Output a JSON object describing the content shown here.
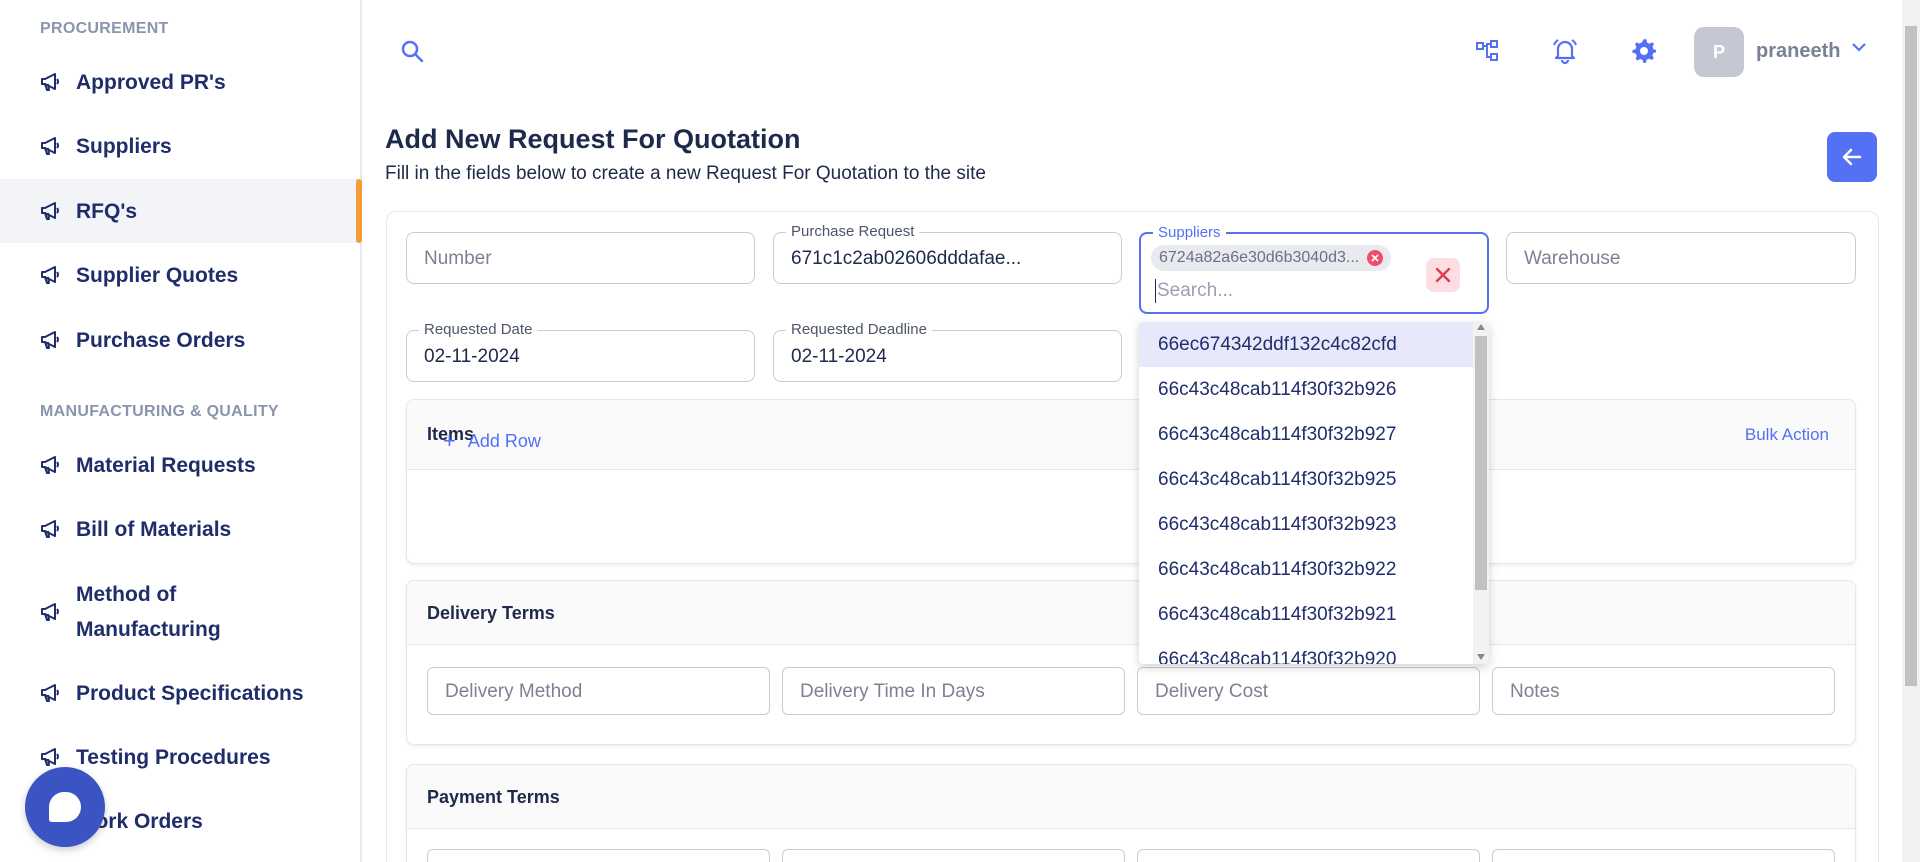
{
  "sidebar": {
    "section_procurement": "PROCUREMENT",
    "section_manufacturing": "MANUFACTURING & QUALITY",
    "items": [
      {
        "label": "Approved PR's"
      },
      {
        "label": "Suppliers"
      },
      {
        "label": "RFQ's"
      },
      {
        "label": "Supplier Quotes"
      },
      {
        "label": "Purchase Orders"
      },
      {
        "label": "Material Requests"
      },
      {
        "label": "Bill of Materials"
      },
      {
        "label": "Method of Manufacturing"
      },
      {
        "label": "Product Specifications"
      },
      {
        "label": "Testing Procedures"
      },
      {
        "label": "Work Orders"
      }
    ]
  },
  "topbar": {
    "avatar_initial": "P",
    "username": "praneeth"
  },
  "page": {
    "title": "Add New Request For Quotation",
    "subtitle": "Fill in the fields below to create a new Request For Quotation to the site"
  },
  "form": {
    "number": {
      "placeholder": "Number"
    },
    "purchase_request": {
      "label": "Purchase Request",
      "value": "671c1c2ab02606dddafae..."
    },
    "suppliers": {
      "label": "Suppliers",
      "chip": "6724a82a6e30d6b3040d3...",
      "search_placeholder": "Search..."
    },
    "warehouse": {
      "placeholder": "Warehouse"
    },
    "requested_date": {
      "label": "Requested Date",
      "value": "02-11-2024"
    },
    "requested_deadline": {
      "label": "Requested Deadline",
      "value": "02-11-2024"
    }
  },
  "items_section": {
    "title": "Items",
    "bulk_action": "Bulk Action",
    "add_row": "Add Row"
  },
  "delivery_section": {
    "title": "Delivery Terms",
    "fields": [
      "Delivery Method",
      "Delivery Time In Days",
      "Delivery Cost",
      "Notes"
    ]
  },
  "payment_section": {
    "title": "Payment Terms"
  },
  "dropdown": {
    "options": [
      "66ec674342ddf132c4c82cfd",
      "66c43c48cab114f30f32b926",
      "66c43c48cab114f30f32b927",
      "66c43c48cab114f30f32b925",
      "66c43c48cab114f30f32b923",
      "66c43c48cab114f30f32b922",
      "66c43c48cab114f30f32b921",
      "66c43c48cab114f30f32b920"
    ]
  },
  "colors": {
    "accent": "#5470f5",
    "active_indicator": "#f39c3a",
    "nav_text": "#1f2d6b",
    "chip_remove": "#ef4e6a"
  }
}
